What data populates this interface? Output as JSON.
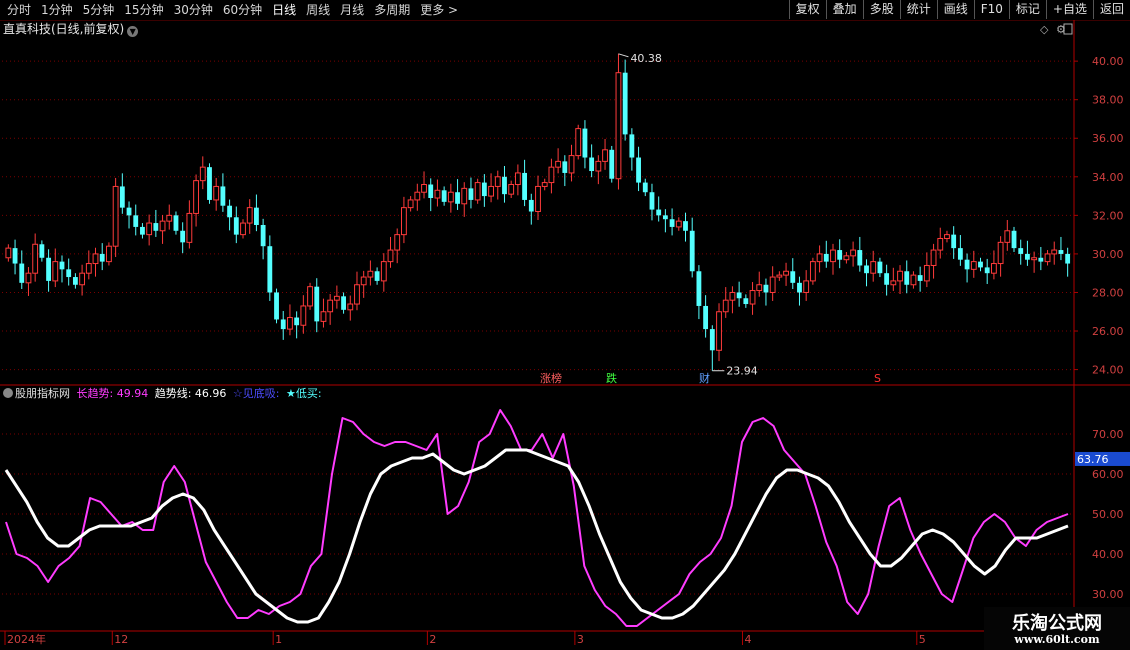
{
  "toolbar": {
    "periods": [
      "分时",
      "1分钟",
      "5分钟",
      "15分钟",
      "30分钟",
      "60分钟",
      "日线",
      "周线",
      "月线",
      "多周期",
      "更多 >"
    ],
    "active": "日线",
    "buttons": [
      "复权",
      "叠加",
      "多股",
      "统计",
      "画线",
      "F10",
      "标记",
      "+自选",
      "返回"
    ]
  },
  "title": "直真科技(日线,前复权)",
  "indicator": {
    "name": "股朋指标网",
    "long_label": "长趋势: 49.94",
    "trend_label": "趋势线: 46.96",
    "bottom_label": "☆见底吸:",
    "buy_label": "★低买:",
    "current_value": "63.76"
  },
  "markers": {
    "zhangbang": "涨榜",
    "die": "跌",
    "cai": "财",
    "s": "S"
  },
  "colors": {
    "up": "#ff3b3b",
    "down": "#54ffff",
    "long": "#ff3cff",
    "trend": "#ffffff",
    "grid": "#7a0000",
    "axis": "#b00000"
  },
  "chart_data": [
    {
      "type": "candlestick",
      "title": "直真科技(日线,前复权)",
      "ylim": [
        23.2,
        41.2
      ],
      "yticks": [
        "40.00",
        "38.00",
        "36.00",
        "34.00",
        "32.00",
        "30.00",
        "28.00",
        "26.00",
        "24.00"
      ],
      "ytick_values": [
        40,
        38,
        36,
        34,
        32,
        30,
        28,
        26,
        24
      ],
      "annotations": [
        {
          "text": "40.38",
          "value": 40.38
        },
        {
          "text": "23.94",
          "value": 23.94
        }
      ],
      "series_summary": "approximately 150 daily candles",
      "close": [
        30.3,
        29.5,
        28.5,
        29.0,
        30.5,
        29.8,
        28.6,
        29.6,
        29.2,
        28.8,
        28.4,
        29.0,
        29.5,
        30.0,
        29.6,
        30.4,
        33.5,
        32.4,
        32.0,
        31.4,
        31.0,
        31.6,
        31.2,
        31.7,
        32.0,
        31.2,
        30.6,
        32.1,
        33.8,
        34.5,
        32.8,
        33.5,
        32.5,
        31.9,
        31.0,
        31.6,
        32.4,
        31.5,
        30.4,
        28.0,
        26.6,
        26.1,
        26.7,
        26.3,
        27.3,
        28.3,
        26.5,
        27.0,
        27.6,
        27.8,
        27.1,
        27.4,
        28.4,
        28.8,
        29.1,
        28.6,
        29.6,
        30.2,
        31.0,
        32.4,
        32.8,
        33.2,
        33.6,
        32.9,
        33.3,
        32.7,
        33.2,
        32.6,
        33.4,
        32.8,
        33.7,
        33.0,
        33.5,
        34.0,
        33.1,
        33.6,
        34.2,
        32.8,
        32.2,
        33.5,
        33.7,
        34.5,
        34.8,
        34.2,
        35.1,
        36.5,
        35.0,
        34.3,
        34.8,
        35.4,
        33.9,
        39.4,
        36.2,
        35.0,
        33.7,
        33.2,
        32.3,
        32.0,
        31.8,
        31.4,
        31.7,
        31.2,
        29.1,
        27.3,
        26.1,
        25.0,
        27.0,
        27.6,
        28.0,
        27.7,
        27.4,
        28.1,
        28.4,
        28.0,
        28.8,
        28.9,
        29.1,
        28.5,
        28.0,
        28.6,
        29.6,
        30.0,
        29.6,
        30.2,
        29.7,
        29.9,
        30.2,
        29.4,
        29.0,
        29.6,
        29.0,
        28.4,
        28.6,
        29.1,
        28.4,
        28.9,
        28.6,
        29.4,
        30.2,
        30.8,
        31.0,
        30.3,
        29.7,
        29.2,
        29.6,
        29.3,
        29.0,
        29.5,
        30.6,
        31.2,
        30.3,
        30.0,
        29.7,
        29.8,
        29.6,
        30.0,
        30.2,
        30.0,
        29.5
      ]
    },
    {
      "type": "line",
      "ylim": [
        21.0,
        78.0
      ],
      "yticks": [
        "70.00",
        "60.00",
        "50.00",
        "40.00",
        "30.00"
      ],
      "ytick_values": [
        70,
        60,
        50,
        40,
        30
      ],
      "series": [
        {
          "name": "长趋势",
          "color": "#ff3cff",
          "values": [
            48,
            40,
            39,
            37,
            33,
            37,
            39,
            42,
            54,
            53,
            50,
            47,
            48,
            46,
            46,
            58,
            62,
            58,
            48,
            38,
            33,
            28,
            24,
            24,
            26,
            25,
            27,
            28,
            30,
            37,
            40,
            60,
            74,
            73,
            70,
            68,
            67,
            68,
            68,
            67,
            66,
            70,
            50,
            52,
            58,
            68,
            70,
            76,
            72,
            66,
            66,
            70,
            64,
            70,
            57,
            37,
            31,
            27,
            25,
            22,
            22,
            24,
            26,
            28,
            30,
            35,
            38,
            40,
            44,
            52,
            68,
            73,
            74,
            72,
            66,
            63,
            60,
            52,
            43,
            37,
            28,
            25,
            30,
            42,
            52,
            54,
            46,
            40,
            35,
            30,
            28,
            36,
            44,
            48,
            50,
            48,
            44,
            42,
            46,
            48,
            49,
            50
          ]
        },
        {
          "name": "趋势线",
          "color": "#ffffff",
          "values": [
            61,
            57,
            53,
            48,
            44,
            42,
            42,
            44,
            46,
            47,
            47,
            47,
            47,
            48,
            49,
            52,
            54,
            55,
            54,
            51,
            46,
            42,
            38,
            34,
            30,
            28,
            26,
            24,
            23,
            23,
            24,
            28,
            33,
            40,
            48,
            55,
            60,
            62,
            63,
            64,
            64,
            65,
            63,
            61,
            60,
            61,
            62,
            64,
            66,
            66,
            66,
            65,
            64,
            63,
            62,
            58,
            52,
            45,
            39,
            33,
            29,
            26,
            25,
            24,
            24,
            25,
            27,
            30,
            33,
            36,
            40,
            45,
            50,
            55,
            59,
            61,
            61,
            60,
            59,
            57,
            53,
            48,
            44,
            40,
            37,
            37,
            39,
            42,
            45,
            46,
            45,
            43,
            40,
            37,
            35,
            37,
            41,
            44,
            44,
            44,
            45,
            46,
            47
          ]
        }
      ]
    }
  ],
  "x_axis": {
    "labels": [
      {
        "text": "2024年",
        "index": 0
      },
      {
        "text": "12",
        "index": 16
      },
      {
        "text": "1",
        "index": 40
      },
      {
        "text": "2",
        "index": 63
      },
      {
        "text": "3",
        "index": 85
      },
      {
        "text": "4",
        "index": 110
      },
      {
        "text": "5",
        "index": 136
      },
      {
        "text": "6",
        "index": 160
      },
      {
        "text": "2025/06",
        "index": 173
      }
    ]
  },
  "watermark": {
    "line1": "乐淘公式网",
    "line2": "www.60lt.com"
  }
}
